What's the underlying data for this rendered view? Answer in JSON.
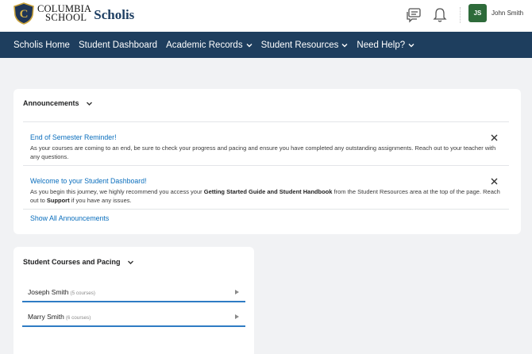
{
  "header": {
    "logo_line1": "COLUMBIA",
    "logo_line2": "SCHOOL",
    "brand": "Scholis",
    "avatar_initials": "JS",
    "user_name": "John Smith",
    "icons": [
      "chat-icon",
      "bell-icon"
    ]
  },
  "nav": {
    "items": [
      {
        "label": "Scholis Home",
        "dropdown": false
      },
      {
        "label": "Student Dashboard",
        "dropdown": false
      },
      {
        "label": "Academic Records",
        "dropdown": true
      },
      {
        "label": "Student Resources",
        "dropdown": true
      },
      {
        "label": "Need Help?",
        "dropdown": true
      }
    ]
  },
  "announcements": {
    "heading": "Announcements",
    "items": [
      {
        "title": "End of Semester Reminder!",
        "body": "As your courses are coming to an end, be sure to check your progress and pacing and ensure you have completed any outstanding assignments. Reach out to your teacher with any questions."
      },
      {
        "title": "Welcome to your Student Dashboard!",
        "body_pre": "As you begin this journey, we highly recommend you access your ",
        "body_bold1": "Getting Started Guide and Student Handbook",
        "body_mid": " from the Student Resources area at the top of the page. Reach out to ",
        "body_bold2": "Support",
        "body_post": " if you have any issues."
      }
    ],
    "show_all": "Show All Announcements"
  },
  "courses": {
    "heading": "Student Courses and Pacing",
    "students": [
      {
        "name": "Joseph Smith",
        "count": "(5 courses)"
      },
      {
        "name": "Marry Smith",
        "count": "(6 courses)"
      }
    ]
  },
  "colors": {
    "nav_bg": "#1e3e5e",
    "link": "#0a6ebd",
    "avatar_bg": "#2e6b3a",
    "student_underline": "#2f7cc4"
  }
}
